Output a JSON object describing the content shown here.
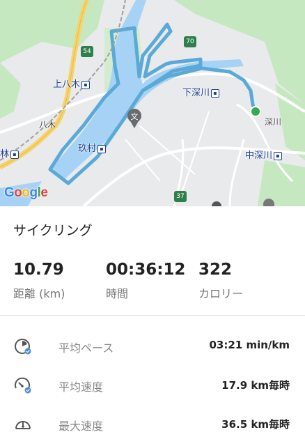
{
  "map": {
    "labels": {
      "kamiyagi": "上八木",
      "yagi": "八木",
      "hayashi": "林",
      "kumura": "玖村",
      "shimofukawa": "下深川",
      "fukawa": "深川",
      "nakafukawa": "中深川"
    },
    "route_badges": [
      "54",
      "70",
      "37"
    ],
    "attribution": "Google",
    "colors": {
      "route": "#5aa9d6",
      "river": "#a6d3f5",
      "green": "#c6e8c0",
      "start_dot": "#34a853"
    }
  },
  "activity": {
    "type": "サイクリング",
    "stats": [
      {
        "value": "10.79",
        "label": "距離 (km)"
      },
      {
        "value": "00:36:12",
        "label": "時間"
      },
      {
        "value": "322",
        "label": "カロリー"
      }
    ],
    "details": [
      {
        "icon": "pace-gauge-icon",
        "label": "平均ペース",
        "value": "03:21 min/km"
      },
      {
        "icon": "speed-gauge-icon",
        "label": "平均速度",
        "value": "17.9 km毎時"
      },
      {
        "icon": "max-speed-gauge-icon",
        "label": "最大速度",
        "value": "36.5 km毎時"
      }
    ]
  }
}
